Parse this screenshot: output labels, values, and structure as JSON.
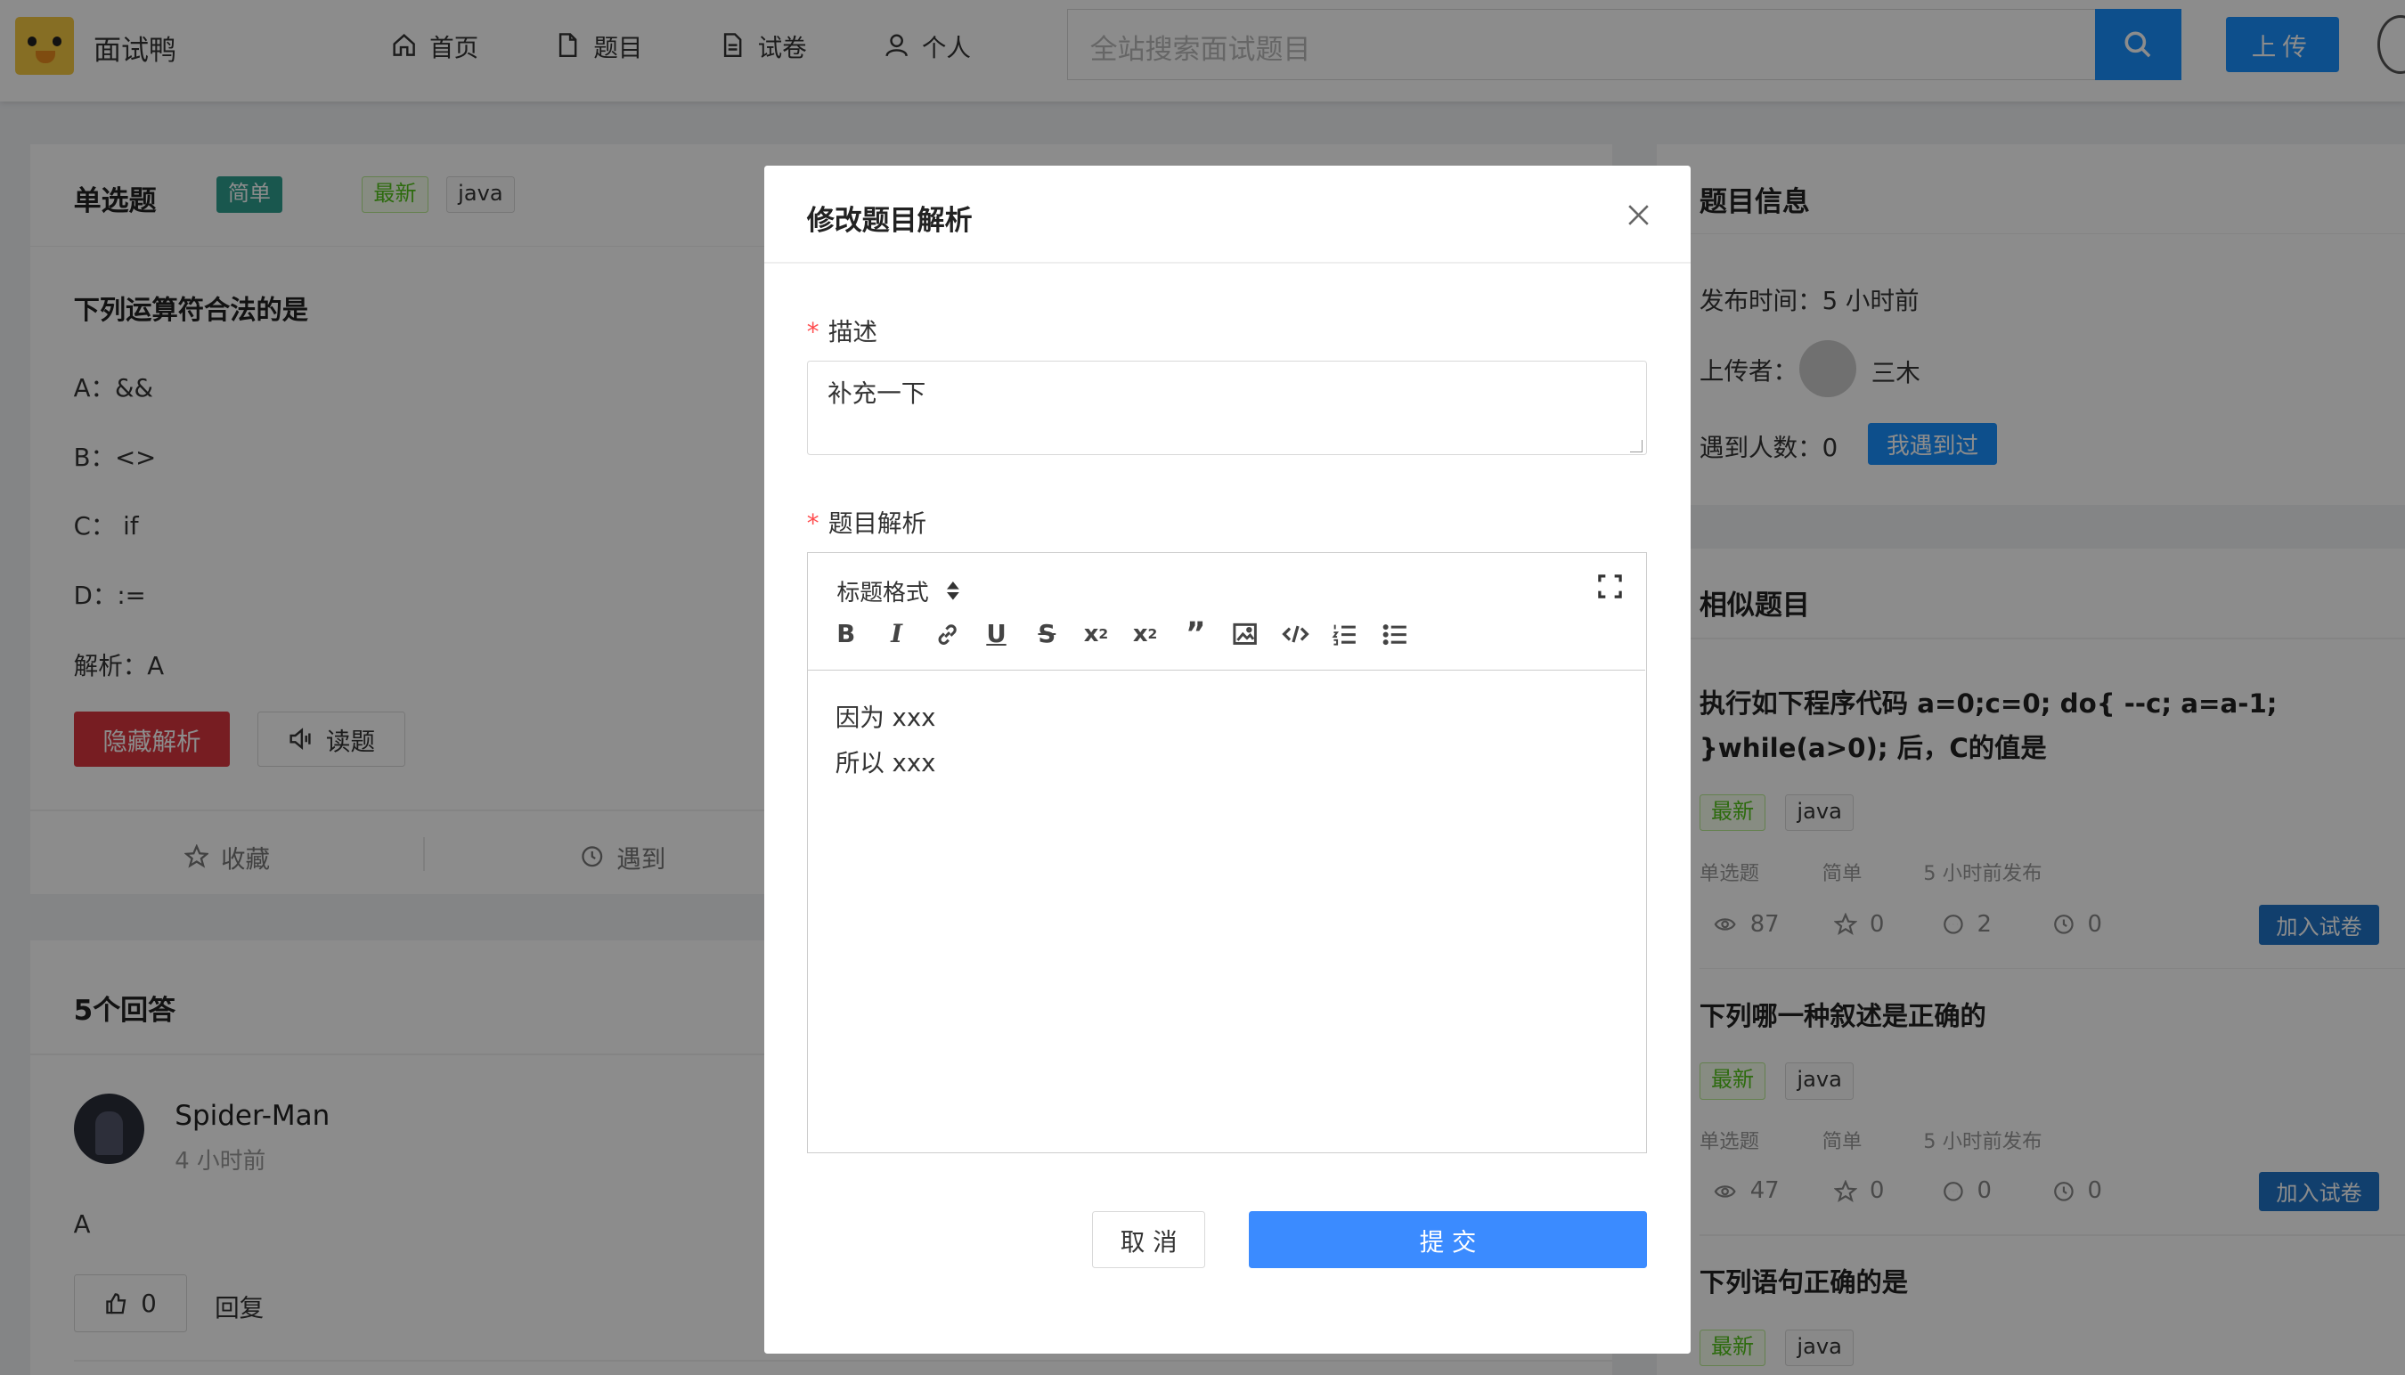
{
  "header": {
    "app_name": "面试鸭",
    "nav": [
      {
        "label": "首页",
        "icon": "home-icon"
      },
      {
        "label": "题目",
        "icon": "file-icon"
      },
      {
        "label": "试卷",
        "icon": "file-text-icon"
      },
      {
        "label": "个人",
        "icon": "user-icon"
      }
    ],
    "search_placeholder": "全站搜索面试题目",
    "upload_label": "上传"
  },
  "question": {
    "type": "单选题",
    "difficulty": "简单",
    "tags": [
      "最新",
      "java"
    ],
    "title": "下列运算符合法的是",
    "options": [
      "A：&&",
      "B：<>",
      "C： if",
      "D：:="
    ],
    "analysis": "解析：A",
    "hide_label": "隐藏解析",
    "read_label": "读题",
    "favorite_label": "收藏",
    "met_label": "遇到"
  },
  "answers": {
    "title": "5个回答",
    "items": [
      {
        "user": "Spider-Man",
        "time": "4 小时前",
        "content": "A",
        "likes": "0",
        "reply_label": "回复"
      }
    ]
  },
  "info": {
    "title": "题目信息",
    "publish": "发布时间：5 小时前",
    "uploader_label": "上传者：",
    "uploader": "三木",
    "met_count": "遇到人数：0",
    "met_button": "我遇到过"
  },
  "similar": {
    "title": "相似题目",
    "items": [
      {
        "title": "执行如下程序代码 a=0;c=0; do{ --c; a=a-1; }while(a>0); 后，C的值是",
        "tags": [
          "最新",
          "java"
        ],
        "type": "单选题",
        "difficulty": "简单",
        "time": "5 小时前发布",
        "views": "87",
        "stars": "0",
        "comments": "2",
        "met": "0",
        "add_label": "加入试卷"
      },
      {
        "title": "下列哪一种叙述是正确的",
        "tags": [
          "最新",
          "java"
        ],
        "type": "单选题",
        "difficulty": "简单",
        "time": "5 小时前发布",
        "views": "47",
        "stars": "0",
        "comments": "0",
        "met": "0",
        "add_label": "加入试卷"
      },
      {
        "title": "下列语句正确的是",
        "tags": [
          "最新",
          "java"
        ]
      }
    ]
  },
  "modal": {
    "title": "修改题目解析",
    "desc_label": "描述",
    "desc_value": "补充一下",
    "analysis_label": "题目解析",
    "heading_select": "标题格式",
    "editor_lines": [
      "因为 xxx",
      "所以 xxx"
    ],
    "cancel_label": "取 消",
    "submit_label": "提 交"
  },
  "colors": {
    "primary": "#1890ff",
    "danger": "#d9363e",
    "teal": "#2e9e8f",
    "tag_green": "#52c41a"
  }
}
